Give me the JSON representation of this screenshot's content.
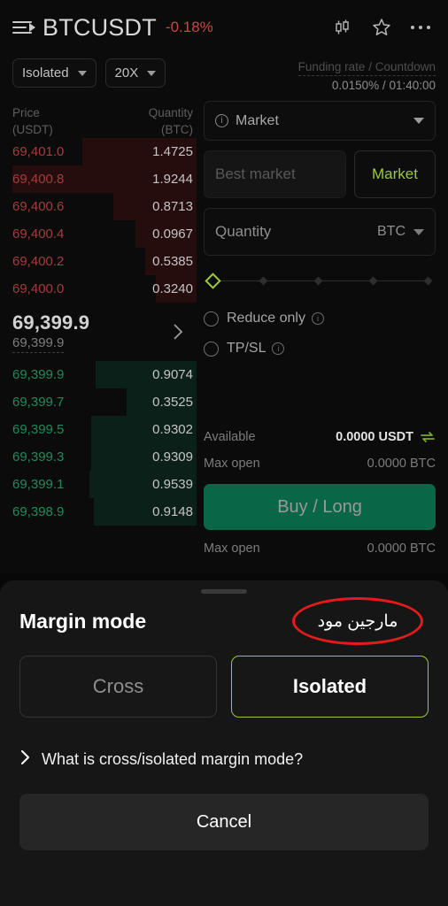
{
  "header": {
    "menu_icon": "list-arrow-icon",
    "pair": "BTCUSDT",
    "change": "-0.18%",
    "change_color": "#c8483f",
    "chart_icon": "candlestick-icon",
    "favorite_icon": "star-icon",
    "more_icon": "more-dots-icon"
  },
  "subheader": {
    "margin_mode": "Isolated",
    "leverage": "20X",
    "funding_label": "Funding rate / Countdown",
    "funding_value": "0.0150% / 01:40:00"
  },
  "orderbook": {
    "col_price_1": "Price",
    "col_price_2": "(USDT)",
    "col_qty_1": "Quantity",
    "col_qty_2": "(BTC)",
    "asks": [
      {
        "price": "69,401.0",
        "qty": "1.4725",
        "depth": 62
      },
      {
        "price": "69,400.8",
        "qty": "1.9244",
        "depth": 100
      },
      {
        "price": "69,400.6",
        "qty": "0.8713",
        "depth": 45
      },
      {
        "price": "69,400.4",
        "qty": "0.0967",
        "depth": 33
      },
      {
        "price": "69,400.2",
        "qty": "0.5385",
        "depth": 28
      },
      {
        "price": "69,400.0",
        "qty": "0.3240",
        "depth": 22
      }
    ],
    "mid_price": "69,399.9",
    "mid_index": "69,399.9",
    "chevron_icon": "chevron-right-icon",
    "bids": [
      {
        "price": "69,399.9",
        "qty": "0.9074",
        "depth": 55
      },
      {
        "price": "69,399.7",
        "qty": "0.3525",
        "depth": 38
      },
      {
        "price": "69,399.5",
        "qty": "0.9302",
        "depth": 57
      },
      {
        "price": "69,399.3",
        "qty": "0.9309",
        "depth": 57
      },
      {
        "price": "69,399.1",
        "qty": "0.9539",
        "depth": 58
      },
      {
        "price": "69,398.9",
        "qty": "0.9148",
        "depth": 56
      }
    ]
  },
  "order_form": {
    "order_type": "Market",
    "order_type_info_icon": "info-icon",
    "price_placeholder": "Best market",
    "market_button": "Market",
    "quantity_label": "Quantity",
    "quantity_unit": "BTC",
    "slider_value": 0,
    "slider_handle_icon": "slider-diamond-handle",
    "reduce_only": "Reduce only",
    "tp_sl": "TP/SL",
    "available_label": "Available",
    "available_value": "0.0000 USDT",
    "swap_icon": "swap-arrows-icon",
    "max_open_label": "Max open",
    "max_open_value": "0.0000  BTC",
    "buy_button": "Buy / Long",
    "buy_button_color": "#096647",
    "max_open_label_2": "Max open",
    "max_open_value_2": "0.0000  BTC"
  },
  "sheet": {
    "grabber": "drag-handle",
    "title": "Margin mode",
    "annotation_text": "مارجین مود",
    "annotation_color": "#e21b1b",
    "cross_label": "Cross",
    "isolated_label": "Isolated",
    "selected_mode": "Isolated",
    "accent_color": "#9cc93a",
    "faq_icon": "chevron-right-icon",
    "faq_text": "What is cross/isolated margin mode?",
    "cancel_label": "Cancel"
  }
}
